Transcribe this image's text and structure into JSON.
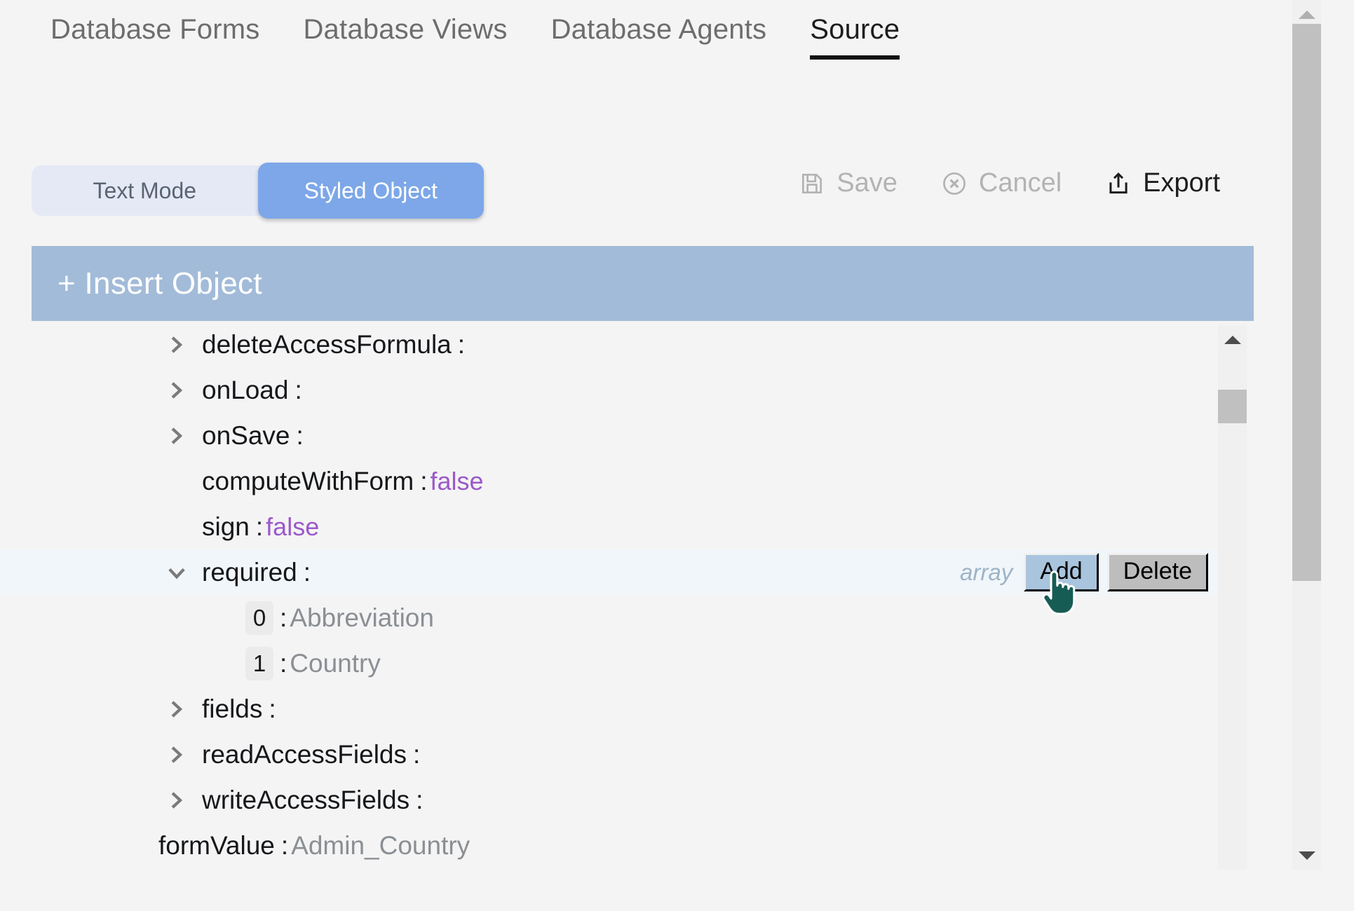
{
  "tabs": [
    {
      "label": "Database Forms",
      "active": false
    },
    {
      "label": "Database Views",
      "active": false
    },
    {
      "label": "Database Agents",
      "active": false
    },
    {
      "label": "Source",
      "active": true
    }
  ],
  "toolbar": {
    "modes": [
      {
        "label": "Text Mode",
        "active": false
      },
      {
        "label": "Styled Object",
        "active": true
      }
    ],
    "actions": [
      {
        "label": "Save",
        "icon": "save-icon",
        "enabled": false
      },
      {
        "label": "Cancel",
        "icon": "cancel-icon",
        "enabled": false
      },
      {
        "label": "Export",
        "icon": "export-icon",
        "enabled": true
      }
    ]
  },
  "insert_bar": {
    "label": "+ Insert Object"
  },
  "tree": {
    "rows": [
      {
        "key": "deleteAccessFormula",
        "colon": ":",
        "value": "",
        "value_type": "none",
        "chevron": "chevron-right",
        "indent": 1,
        "highlight": false
      },
      {
        "key": "onLoad",
        "colon": ":",
        "value": "",
        "value_type": "none",
        "chevron": "chevron-right",
        "indent": 1,
        "highlight": false
      },
      {
        "key": "onSave",
        "colon": ":",
        "value": "",
        "value_type": "none",
        "chevron": "chevron-right",
        "indent": 1,
        "highlight": false
      },
      {
        "key": "computeWithForm",
        "colon": ":",
        "value": "false",
        "value_type": "boolean",
        "chevron": "none",
        "indent": 1,
        "highlight": false
      },
      {
        "key": "sign",
        "colon": ":",
        "value": "false",
        "value_type": "boolean",
        "chevron": "none",
        "indent": 1,
        "highlight": false
      },
      {
        "key": "required",
        "colon": ":",
        "value": "",
        "value_type": "none",
        "chevron": "chevron-down",
        "indent": 1,
        "highlight": true,
        "type_tag": "array",
        "buttons": [
          {
            "label": "Add",
            "state": "hover"
          },
          {
            "label": "Delete",
            "state": "normal"
          }
        ]
      },
      {
        "key": "0",
        "key_style": "index-chip",
        "colon": ":",
        "value": "Abbreviation",
        "value_type": "string",
        "chevron": "none",
        "indent": 2,
        "highlight": false
      },
      {
        "key": "1",
        "key_style": "index-chip",
        "colon": ":",
        "value": "Country",
        "value_type": "string",
        "chevron": "none",
        "indent": 2,
        "highlight": false
      },
      {
        "key": "fields",
        "colon": ":",
        "value": "",
        "value_type": "none",
        "chevron": "chevron-right",
        "indent": 1,
        "highlight": false
      },
      {
        "key": "readAccessFields",
        "colon": ":",
        "value": "",
        "value_type": "none",
        "chevron": "chevron-right",
        "indent": 1,
        "highlight": false
      },
      {
        "key": "writeAccessFields",
        "colon": ":",
        "value": "",
        "value_type": "none",
        "chevron": "chevron-right",
        "indent": 1,
        "highlight": false
      },
      {
        "key": "formValue",
        "colon": ":",
        "value": "Admin_Country",
        "value_type": "string",
        "chevron": "none",
        "indent": 0,
        "highlight": false
      }
    ]
  },
  "scrollbars": {
    "inner": {
      "up_arrow": "triangle-up",
      "down_arrow": "none"
    },
    "outer": {
      "up_arrow": "triangle-up",
      "down_arrow": "triangle-down"
    }
  },
  "colors": {
    "accent_blue": "#7da7e8",
    "insert_bar": "#a2bbd8",
    "boolean_value": "#9b59c9",
    "string_value": "#8b8f94",
    "type_tag": "#9db4c7",
    "highlight_row": "#f1f6fa",
    "page_bg": "#f4f4f4",
    "cursor": "#175c54"
  },
  "cursor": {
    "type": "pointing-hand"
  }
}
